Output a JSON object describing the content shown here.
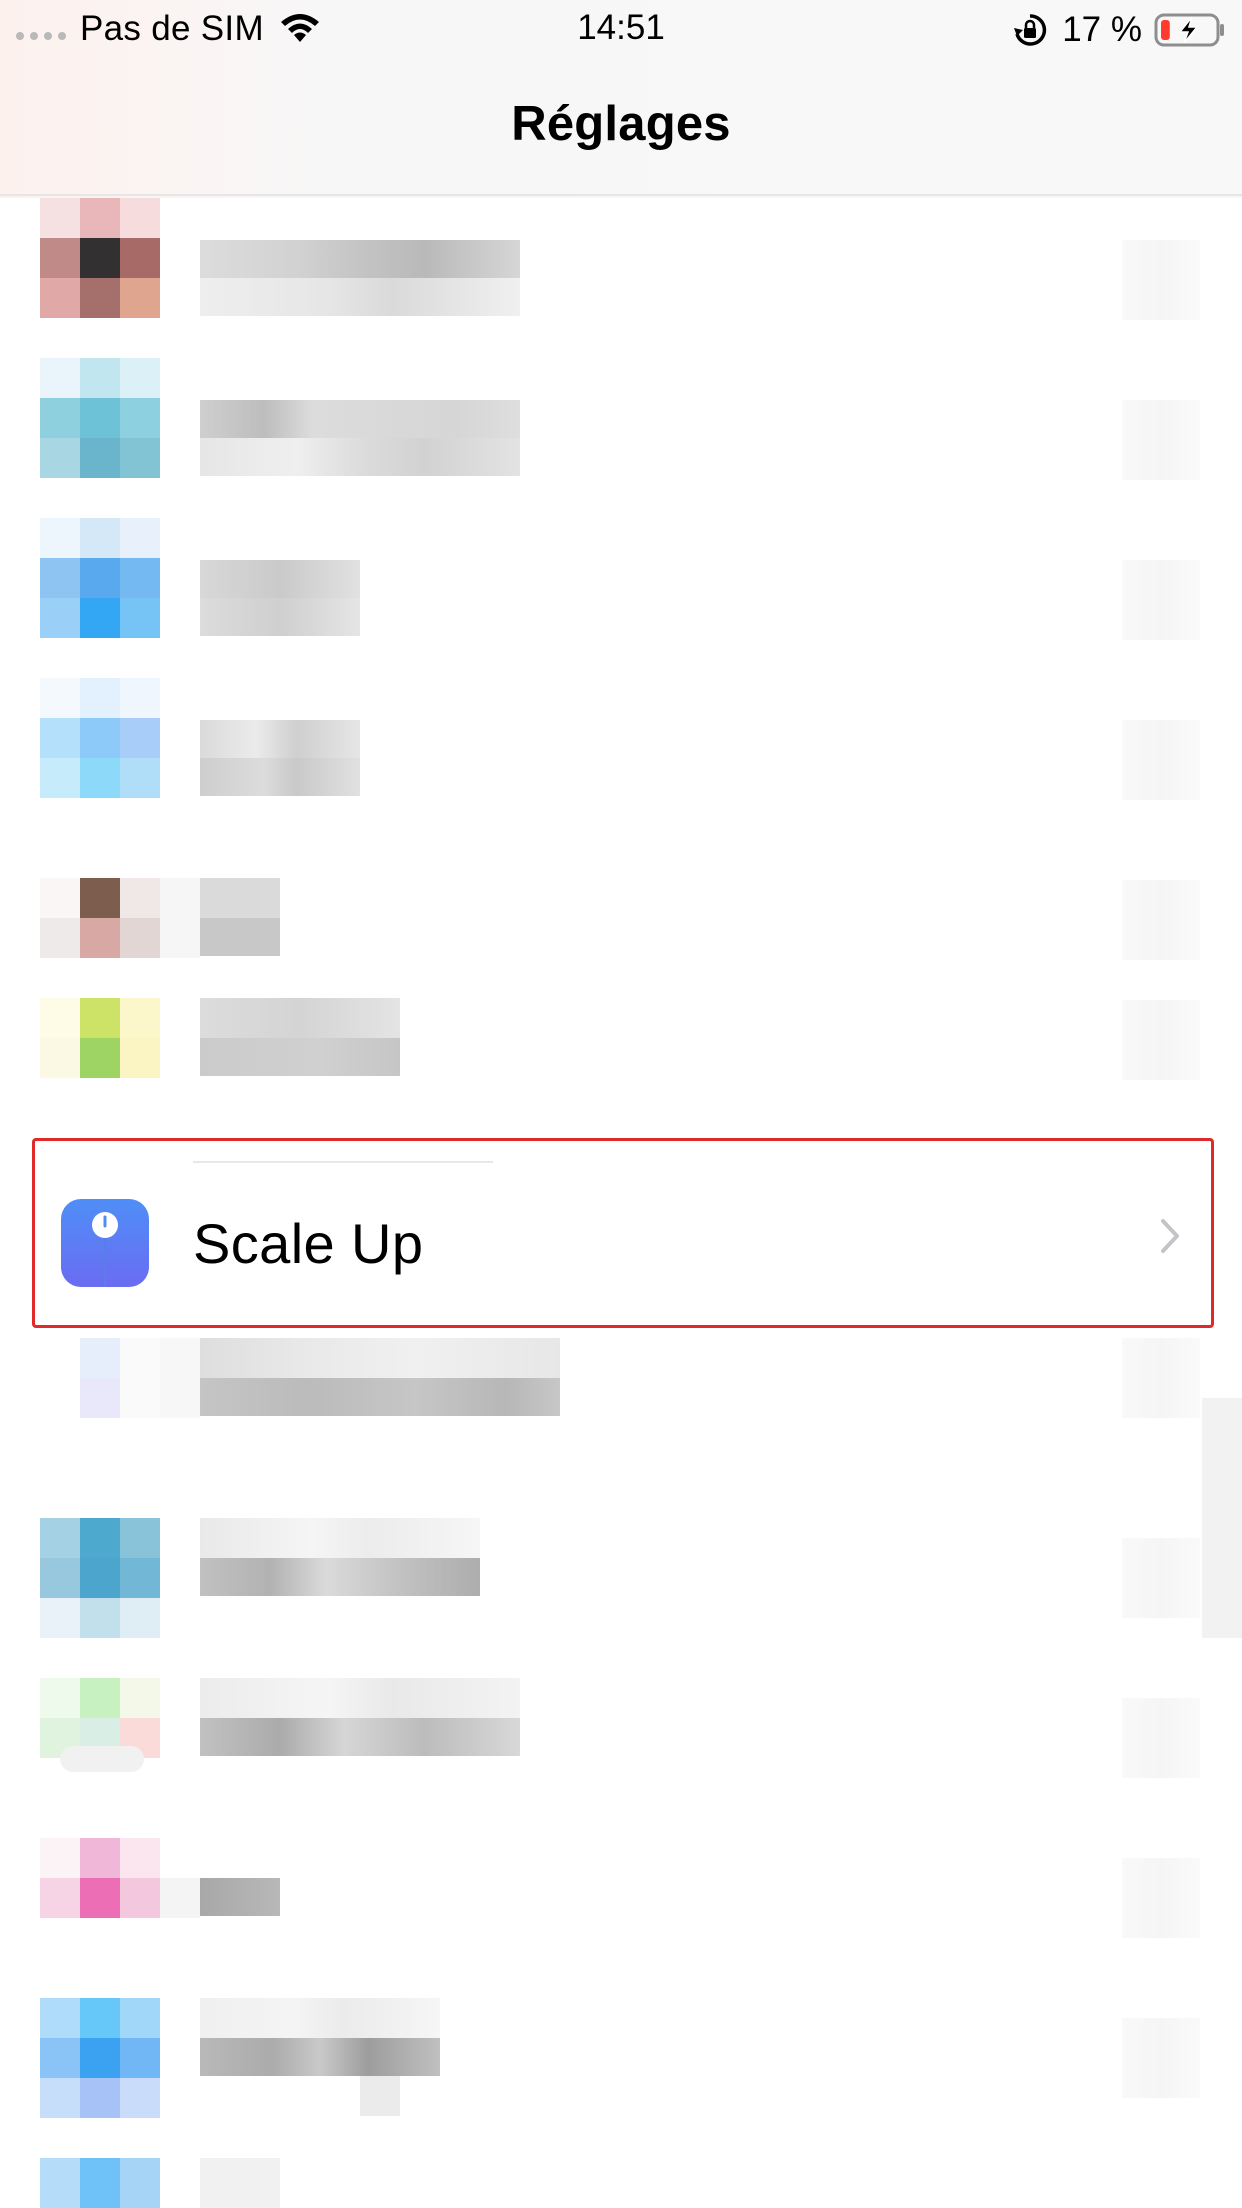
{
  "status_bar": {
    "carrier": "Pas de SIM",
    "time": "14:51",
    "battery_percent": "17 %",
    "battery_level": 0.17,
    "battery_charging": true,
    "icons": [
      "signal-dots-icon",
      "wifi-icon",
      "rotation-lock-icon",
      "battery-charging-icon"
    ]
  },
  "nav": {
    "title": "Réglages"
  },
  "highlighted_item": {
    "label": "Scale Up",
    "icon": "scale-app-icon",
    "chevron_icon": "chevron-right-icon"
  },
  "colors": {
    "highlight_border": "#e02a2a",
    "app_icon_top": "#4f8ef7",
    "app_icon_bottom": "#6a6cf2"
  }
}
